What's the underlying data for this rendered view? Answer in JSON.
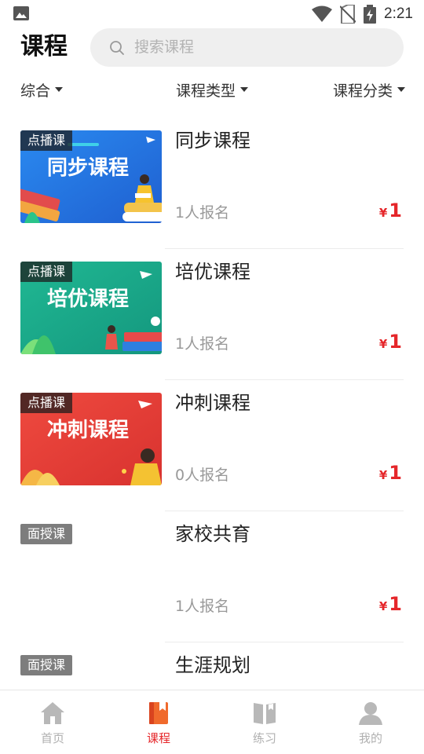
{
  "status_bar": {
    "time": "2:21"
  },
  "header": {
    "title": "课程",
    "search_placeholder": "搜索课程"
  },
  "filters": [
    {
      "label": "综合"
    },
    {
      "label": "课程类型"
    },
    {
      "label": "课程分类"
    }
  ],
  "courses": [
    {
      "badge": "点播课",
      "name": "同步课程",
      "thumb_title": "同步课程",
      "enrolled": "1人报名",
      "currency": "¥",
      "price": "1",
      "thumb_color": "#2f7fe0"
    },
    {
      "badge": "点播课",
      "name": "培优课程",
      "thumb_title": "培优课程",
      "enrolled": "1人报名",
      "currency": "¥",
      "price": "1",
      "thumb_color": "#1fae8c"
    },
    {
      "badge": "点播课",
      "name": "冲刺课程",
      "thumb_title": "冲刺课程",
      "enrolled": "0人报名",
      "currency": "¥",
      "price": "1",
      "thumb_color": "#e8413a"
    },
    {
      "badge": "面授课",
      "name": "家校共育",
      "enrolled": "1人报名",
      "currency": "¥",
      "price": "1"
    },
    {
      "badge": "面授课",
      "name": "生涯规划"
    }
  ],
  "tabs": [
    {
      "label": "首页",
      "icon": "home-icon",
      "active": false
    },
    {
      "label": "课程",
      "icon": "course-book-icon",
      "active": true
    },
    {
      "label": "练习",
      "icon": "open-book-icon",
      "active": false
    },
    {
      "label": "我的",
      "icon": "user-icon",
      "active": false
    }
  ],
  "colors": {
    "accent": "#e5262a",
    "inactive_tab": "#b0b0b0",
    "search_bg": "#efefef"
  }
}
